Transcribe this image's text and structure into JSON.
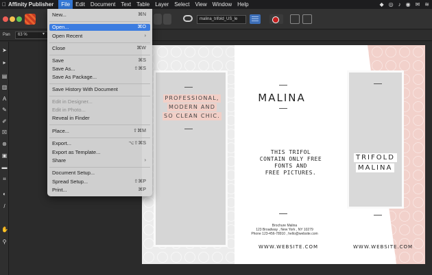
{
  "menubar": {
    "apple": "",
    "app_name": "Affinity Publisher",
    "items": [
      "File",
      "Edit",
      "Document",
      "Text",
      "Table",
      "Layer",
      "Select",
      "View",
      "Window",
      "Help"
    ]
  },
  "toolbar": {
    "document_name": "malina_trifold_US_le"
  },
  "context_toolbar": {
    "tool_label": "Pan",
    "zoom": "63 %"
  },
  "file_menu": {
    "items": [
      {
        "label": "New...",
        "shortcut": "⌘N"
      },
      {
        "label": "Open...",
        "shortcut": "⌘O",
        "highlighted": true
      },
      {
        "label": "Open Recent",
        "shortcut": "›"
      },
      {
        "label": "Close",
        "shortcut": "⌘W"
      },
      {
        "label": "Save",
        "shortcut": "⌘S"
      },
      {
        "label": "Save As...",
        "shortcut": "⇧⌘S"
      },
      {
        "label": "Save As Package...",
        "shortcut": ""
      },
      {
        "label": "Save History With Document",
        "shortcut": ""
      },
      {
        "label": "Edit in Designer...",
        "shortcut": "",
        "disabled": true
      },
      {
        "label": "Edit in Photo...",
        "shortcut": "",
        "disabled": true
      },
      {
        "label": "Reveal in Finder",
        "shortcut": ""
      },
      {
        "label": "Place...",
        "shortcut": "⇧⌘M"
      },
      {
        "label": "Export...",
        "shortcut": "⌥⇧⌘S"
      },
      {
        "label": "Export as Template...",
        "shortcut": ""
      },
      {
        "label": "Share",
        "shortcut": "›"
      },
      {
        "label": "Document Setup...",
        "shortcut": ""
      },
      {
        "label": "Spread Setup...",
        "shortcut": "⇧⌘P"
      },
      {
        "label": "Print...",
        "shortcut": "⌘P"
      }
    ]
  },
  "document": {
    "professional_lines": [
      "PROFESSIONAL,",
      "MODERN AND",
      "SO CLEAN CHIC."
    ],
    "title": "MALINA",
    "trifol_lines": [
      "THIS TRIFOL",
      "CONTAIN ONLY FREE",
      "FONTS AND",
      "FREE PICTURES."
    ],
    "brochure_lines": [
      "Brochure Malina",
      "123 Broadway , New York , NY 10279",
      "Phone 123-456-78910 , hello@website.com"
    ],
    "website_mid": "WWW.WEBSITE.COM",
    "website_right": "WWW.WEBSITE.COM",
    "trifold_title": "TRIFOLD",
    "trifold_sub": "MALINA"
  }
}
